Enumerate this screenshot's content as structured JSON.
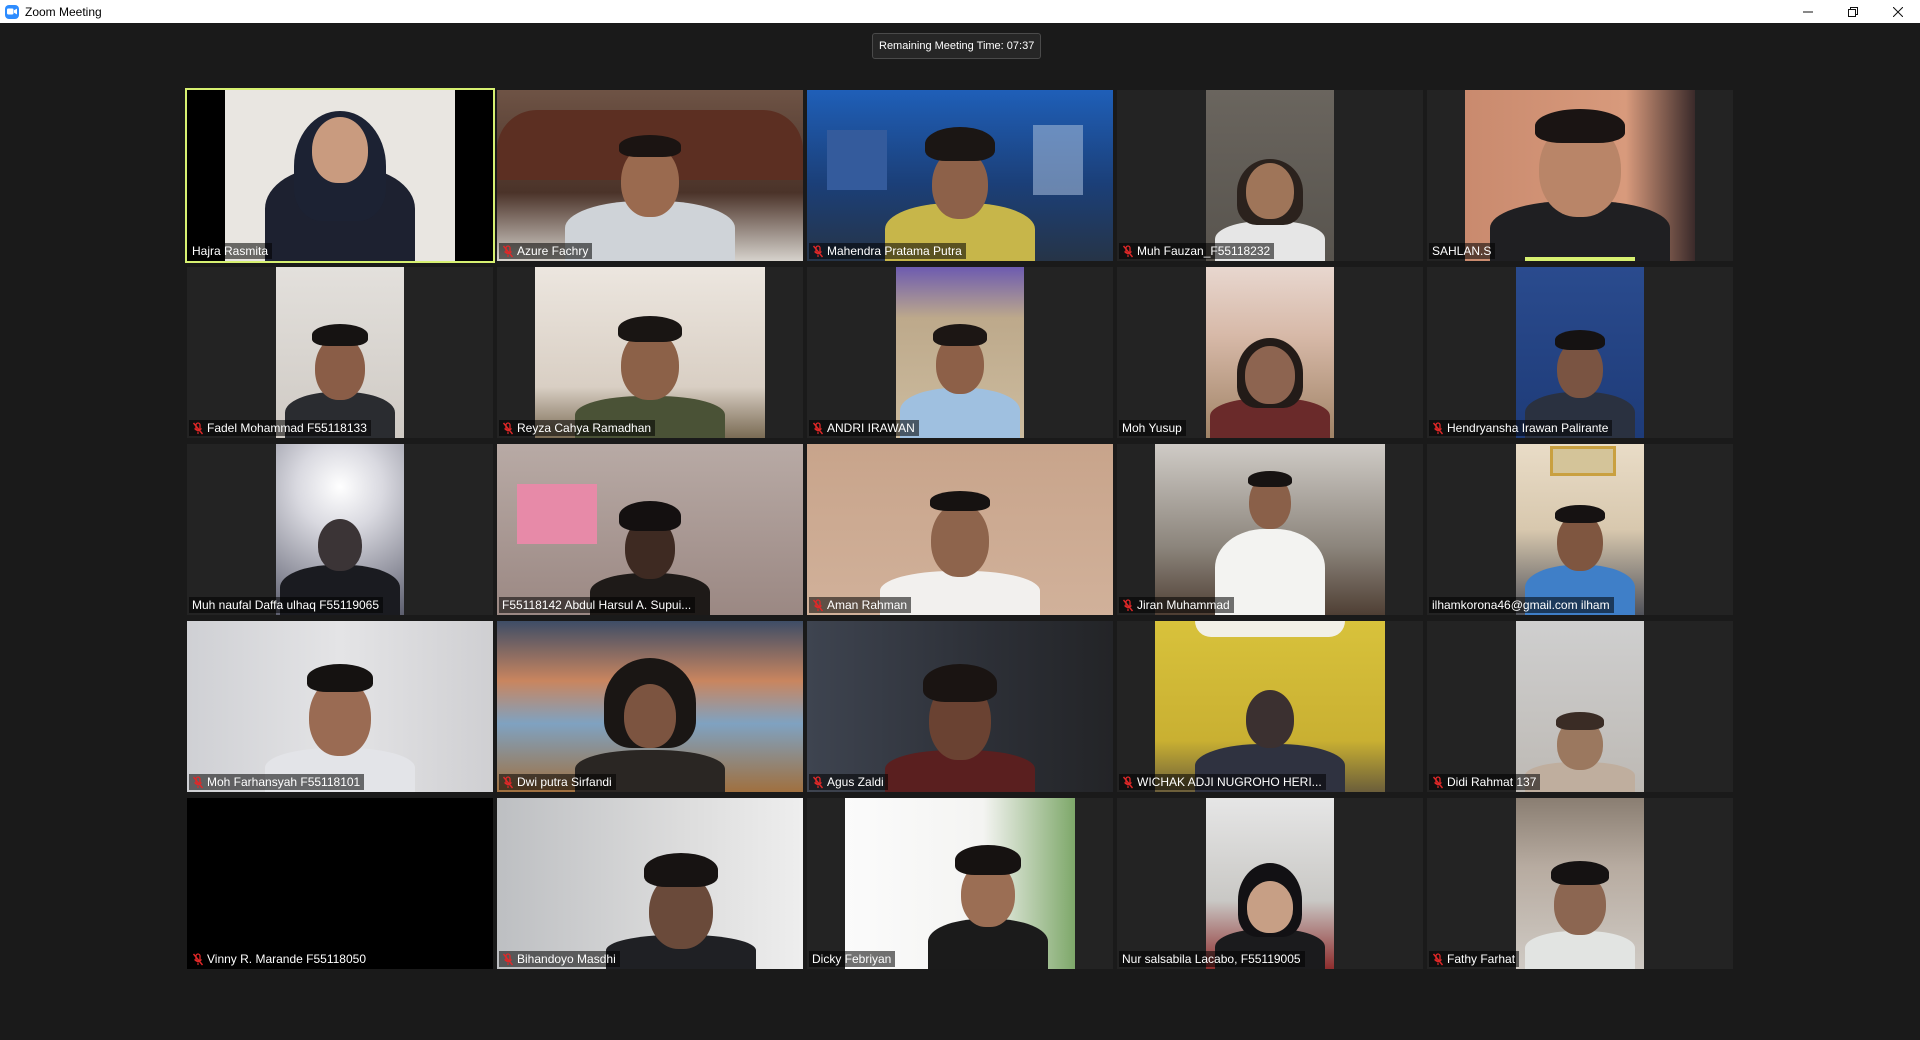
{
  "window": {
    "title": "Zoom Meeting",
    "minimize": "—",
    "restore": "❐",
    "close": "✕"
  },
  "timer": "Remaining Meeting Time: 07:37",
  "accent_color": "#d7f071",
  "muted_icon_color": "#e02828",
  "participants": [
    {
      "name": "Hajra Rasmita",
      "muted": false
    },
    {
      "name": "Azure Fachry",
      "muted": true
    },
    {
      "name": "Mahendra Pratama Putra",
      "muted": true
    },
    {
      "name": "Muh Fauzan_F55118232",
      "muted": true
    },
    {
      "name": "SAHLAN.S",
      "muted": false
    },
    {
      "name": "Fadel Mohammad F55118133",
      "muted": true
    },
    {
      "name": "Reyza Cahya Ramadhan",
      "muted": true
    },
    {
      "name": "ANDRI IRAWAN",
      "muted": true
    },
    {
      "name": "Moh Yusup",
      "muted": false
    },
    {
      "name": "Hendryansha Irawan Palirante",
      "muted": true
    },
    {
      "name": "Muh naufal Daffa ulhaq F55119065",
      "muted": false
    },
    {
      "name": "F55118142 Abdul Harsul A. Supui...",
      "muted": false
    },
    {
      "name": "Aman Rahman",
      "muted": true
    },
    {
      "name": "Jiran Muhammad",
      "muted": true
    },
    {
      "name": "ilhamkorona46@gmail.com ilham",
      "muted": false
    },
    {
      "name": "Moh Farhansyah F55118101",
      "muted": true
    },
    {
      "name": "Dwi putra Sirfandi",
      "muted": true
    },
    {
      "name": "Agus Zaldi",
      "muted": true
    },
    {
      "name": "WICHAK ADJI NUGROHO HERI...",
      "muted": true
    },
    {
      "name": "Didi Rahmat 137",
      "muted": true
    },
    {
      "name": "Vinny R. Marande F55118050",
      "muted": true
    },
    {
      "name": "Bihandoyo Masdhi",
      "muted": true
    },
    {
      "name": "Dicky Febriyan",
      "muted": false
    },
    {
      "name": "Nur salsabila Lacabo, F55119005",
      "muted": false
    },
    {
      "name": "Fathy Farhat",
      "muted": true
    }
  ]
}
